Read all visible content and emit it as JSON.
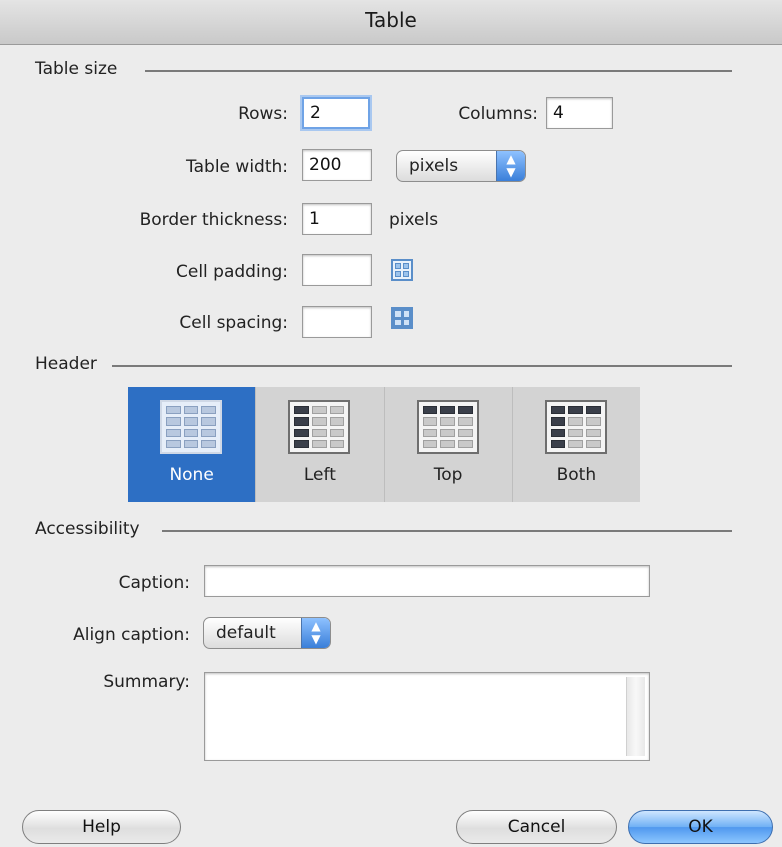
{
  "window": {
    "title": "Table"
  },
  "table_size": {
    "section_label": "Table size",
    "rows_label": "Rows:",
    "rows_value": "2",
    "columns_label": "Columns:",
    "columns_value": "4",
    "width_label": "Table width:",
    "width_value": "200",
    "width_unit": "pixels",
    "border_label": "Border thickness:",
    "border_value": "1",
    "border_unit": "pixels",
    "padding_label": "Cell padding:",
    "padding_value": "",
    "spacing_label": "Cell spacing:",
    "spacing_value": ""
  },
  "header": {
    "section_label": "Header",
    "options": [
      {
        "label": "None",
        "selected": true
      },
      {
        "label": "Left",
        "selected": false
      },
      {
        "label": "Top",
        "selected": false
      },
      {
        "label": "Both",
        "selected": false
      }
    ]
  },
  "accessibility": {
    "section_label": "Accessibility",
    "caption_label": "Caption:",
    "caption_value": "",
    "align_label": "Align caption:",
    "align_value": "default",
    "summary_label": "Summary:",
    "summary_value": ""
  },
  "buttons": {
    "help": "Help",
    "cancel": "Cancel",
    "ok": "OK"
  },
  "colors": {
    "accent": "#2d6fc4",
    "background": "#ececec"
  }
}
